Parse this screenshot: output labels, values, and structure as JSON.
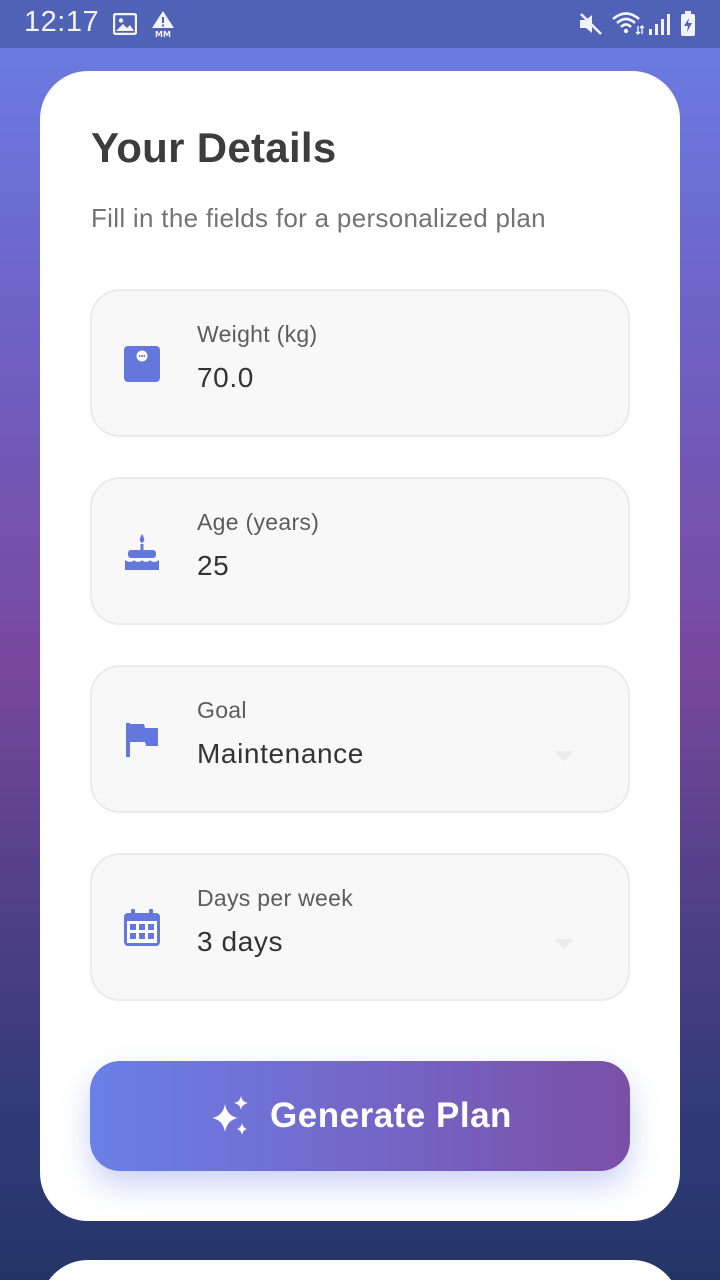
{
  "status_bar": {
    "time": "12:17",
    "icons": [
      "image-icon",
      "alert-mm-icon",
      "mute-icon",
      "wifi-icon",
      "signal-icon",
      "battery-icon"
    ]
  },
  "form": {
    "title": "Your Details",
    "subtitle": "Fill in the fields for a personalized plan",
    "fields": [
      {
        "label": "Weight (kg)",
        "value": "70.0",
        "icon": "scale-icon"
      },
      {
        "label": "Age (years)",
        "value": "25",
        "icon": "cake-icon"
      },
      {
        "label": "Goal",
        "value": "Maintenance",
        "icon": "flag-icon"
      },
      {
        "label": "Days per week",
        "value": "3 days",
        "icon": "calendar-icon"
      }
    ],
    "generate_label": "Generate Plan",
    "generate_icon": "sparkle-icon"
  },
  "colors": {
    "accent": "#6a80e8",
    "icon": "#6477dd",
    "button_end": "#7a4fa6"
  }
}
